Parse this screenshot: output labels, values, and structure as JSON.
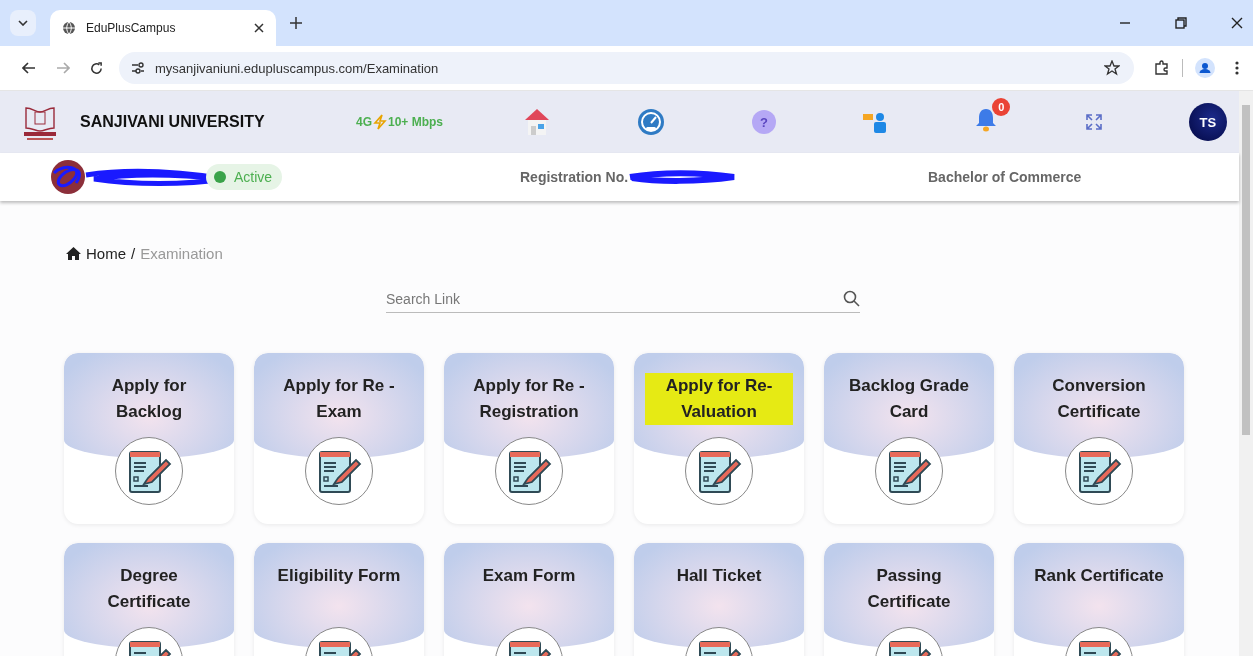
{
  "browser": {
    "tab_title": "EduPlusCampus",
    "url": "mysanjivaniuni.edupluscampus.com/Examination"
  },
  "header": {
    "university": "SANJIVANI UNIVERSITY",
    "network": "4G",
    "speed": "10+ Mbps",
    "notification_count": "0",
    "avatar_initials": "TS"
  },
  "student": {
    "status": "Active",
    "registration_label": "Registration No.",
    "program": "Bachelor of Commerce"
  },
  "help_glyph": "?",
  "breadcrumb_separator": "/",
  "breadcrumb": [
    {
      "label": "Home",
      "current": false
    },
    {
      "label": "Examination",
      "current": true
    }
  ],
  "search": {
    "placeholder": "Search Link"
  },
  "cards": [
    {
      "title": "Apply for Backlog",
      "highlighted": false
    },
    {
      "title": "Apply for Re - Exam",
      "highlighted": false
    },
    {
      "title": "Apply for Re - Registration",
      "highlighted": false
    },
    {
      "title": "Apply for Re-Valuation",
      "highlighted": true
    },
    {
      "title": "Backlog Grade Card",
      "highlighted": false
    },
    {
      "title": "Conversion Certificate",
      "highlighted": false
    },
    {
      "title": "Degree Certificate",
      "highlighted": false
    },
    {
      "title": "Eligibility Form",
      "highlighted": false
    },
    {
      "title": "Exam Form",
      "highlighted": false
    },
    {
      "title": "Hall Ticket",
      "highlighted": false
    },
    {
      "title": "Passing Certificate",
      "highlighted": false
    },
    {
      "title": "Rank Certificate",
      "highlighted": false
    }
  ]
}
